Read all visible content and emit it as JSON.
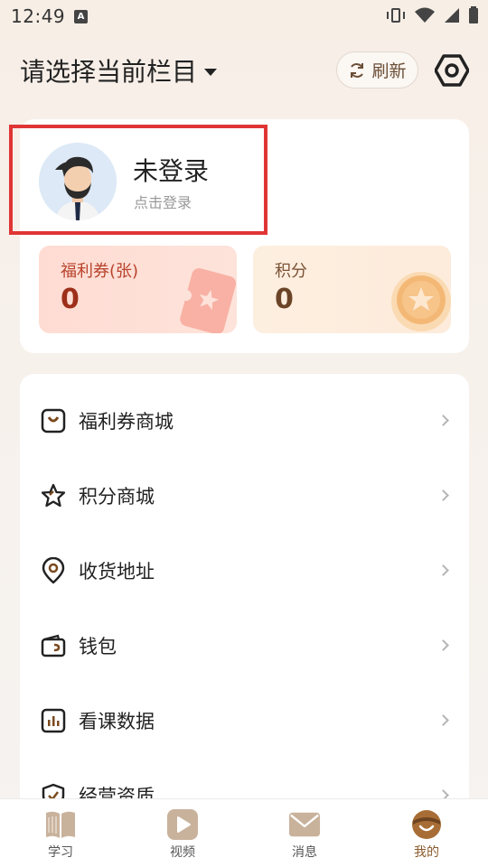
{
  "status_bar": {
    "time": "12:49",
    "notification_badge": "A"
  },
  "header": {
    "column_title": "请选择当前栏目",
    "refresh_label": "刷新"
  },
  "user": {
    "login_title": "未登录",
    "login_subtitle": "点击登录"
  },
  "stats": {
    "coupons": {
      "label": "福利券(张)",
      "value": "0"
    },
    "points": {
      "label": "积分",
      "value": "0"
    }
  },
  "menu": {
    "items": [
      {
        "label": "福利券商城",
        "icon": "bag-icon"
      },
      {
        "label": "积分商城",
        "icon": "star-icon"
      },
      {
        "label": "收货地址",
        "icon": "location-pin-icon"
      },
      {
        "label": "钱包",
        "icon": "wallet-icon"
      },
      {
        "label": "看课数据",
        "icon": "bar-chart-icon"
      },
      {
        "label": "经营资质",
        "icon": "shield-check-icon"
      }
    ]
  },
  "tabs": [
    {
      "label": "学习",
      "icon": "book-icon",
      "active": false
    },
    {
      "label": "视频",
      "icon": "play-icon",
      "active": false
    },
    {
      "label": "消息",
      "icon": "mail-icon",
      "active": false
    },
    {
      "label": "我的",
      "icon": "smile-icon",
      "active": true
    }
  ],
  "colors": {
    "accent": "#8a5a2b",
    "highlight_border": "#e03535",
    "coupon_text": "#b8432c",
    "points_text": "#6b4428"
  }
}
